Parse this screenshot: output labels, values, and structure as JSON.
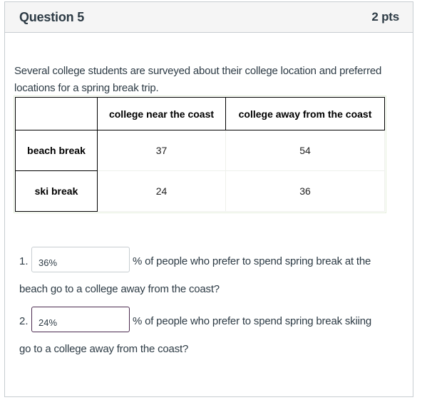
{
  "header": {
    "title": "Question 5",
    "points": "2 pts"
  },
  "prompt": "Several college students are surveyed about their college location and preferred locations for a spring break trip.",
  "table": {
    "columns": [
      "",
      "college near the coast",
      "college away from the coast"
    ],
    "rows": [
      {
        "label": "beach break",
        "values": [
          "37",
          "54"
        ]
      },
      {
        "label": "ski break",
        "values": [
          "24",
          "36"
        ]
      }
    ]
  },
  "questions": [
    {
      "number": "1.",
      "answer": "36%",
      "text_inline": "% of people who prefer to spend spring break at the",
      "text_continued": "beach go to a college away from the coast?",
      "focused": false
    },
    {
      "number": "2.",
      "answer": "24%",
      "text_inline": "% of people who prefer to spend spring break skiing",
      "text_continued": "go to a college away from the coast?",
      "focused": true
    }
  ],
  "colors": {
    "header_bg": "#f5f5f5",
    "text": "#2d3b45",
    "card_border": "#c7cdd1",
    "focus_border": "#4b2a4f"
  }
}
